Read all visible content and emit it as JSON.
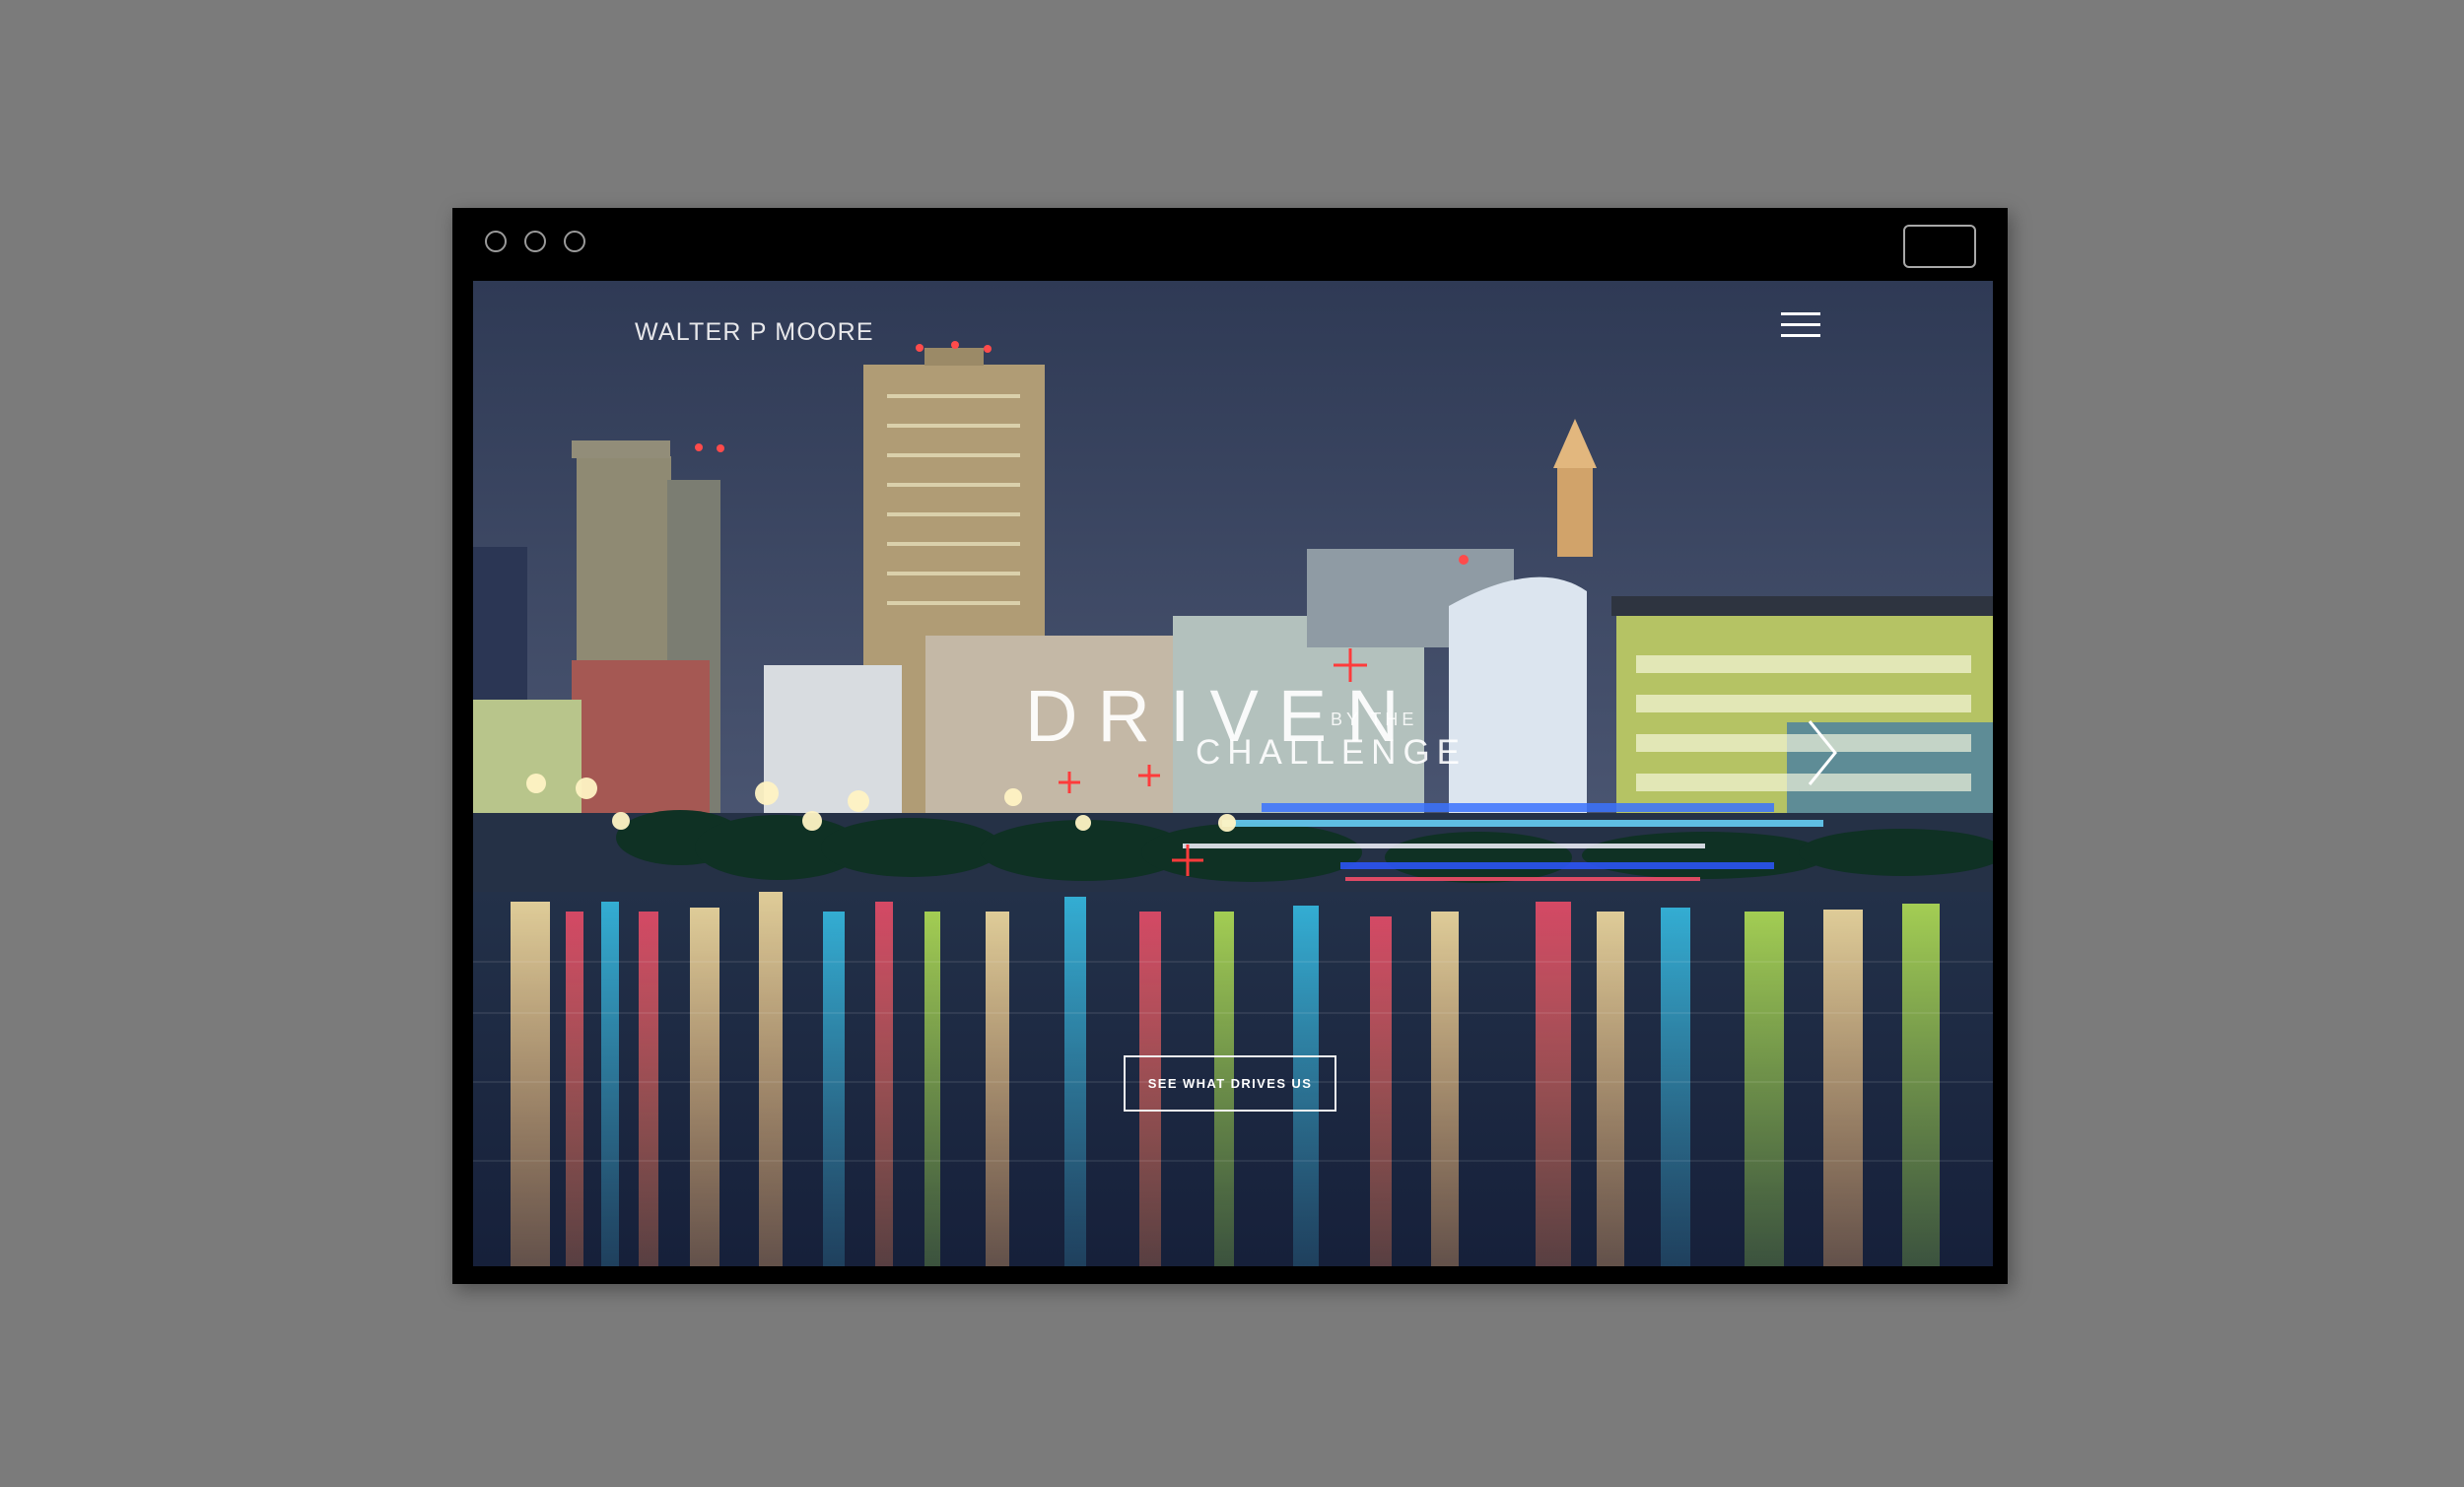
{
  "site": {
    "logo": "WALTER P MOORE"
  },
  "hero": {
    "title_main": "DRIVEN",
    "title_small": "BY THE",
    "title_sub": "CHALLENGE",
    "cta_label": "SEE WHAT DRIVES US"
  },
  "colors": {
    "page_background": "#7b7b7b",
    "window_frame": "#000000",
    "accent_red": "#ff3b3b",
    "text": "#ffffff"
  },
  "icons": {
    "menu": "hamburger-menu-icon",
    "next": "chevron-right-icon"
  }
}
